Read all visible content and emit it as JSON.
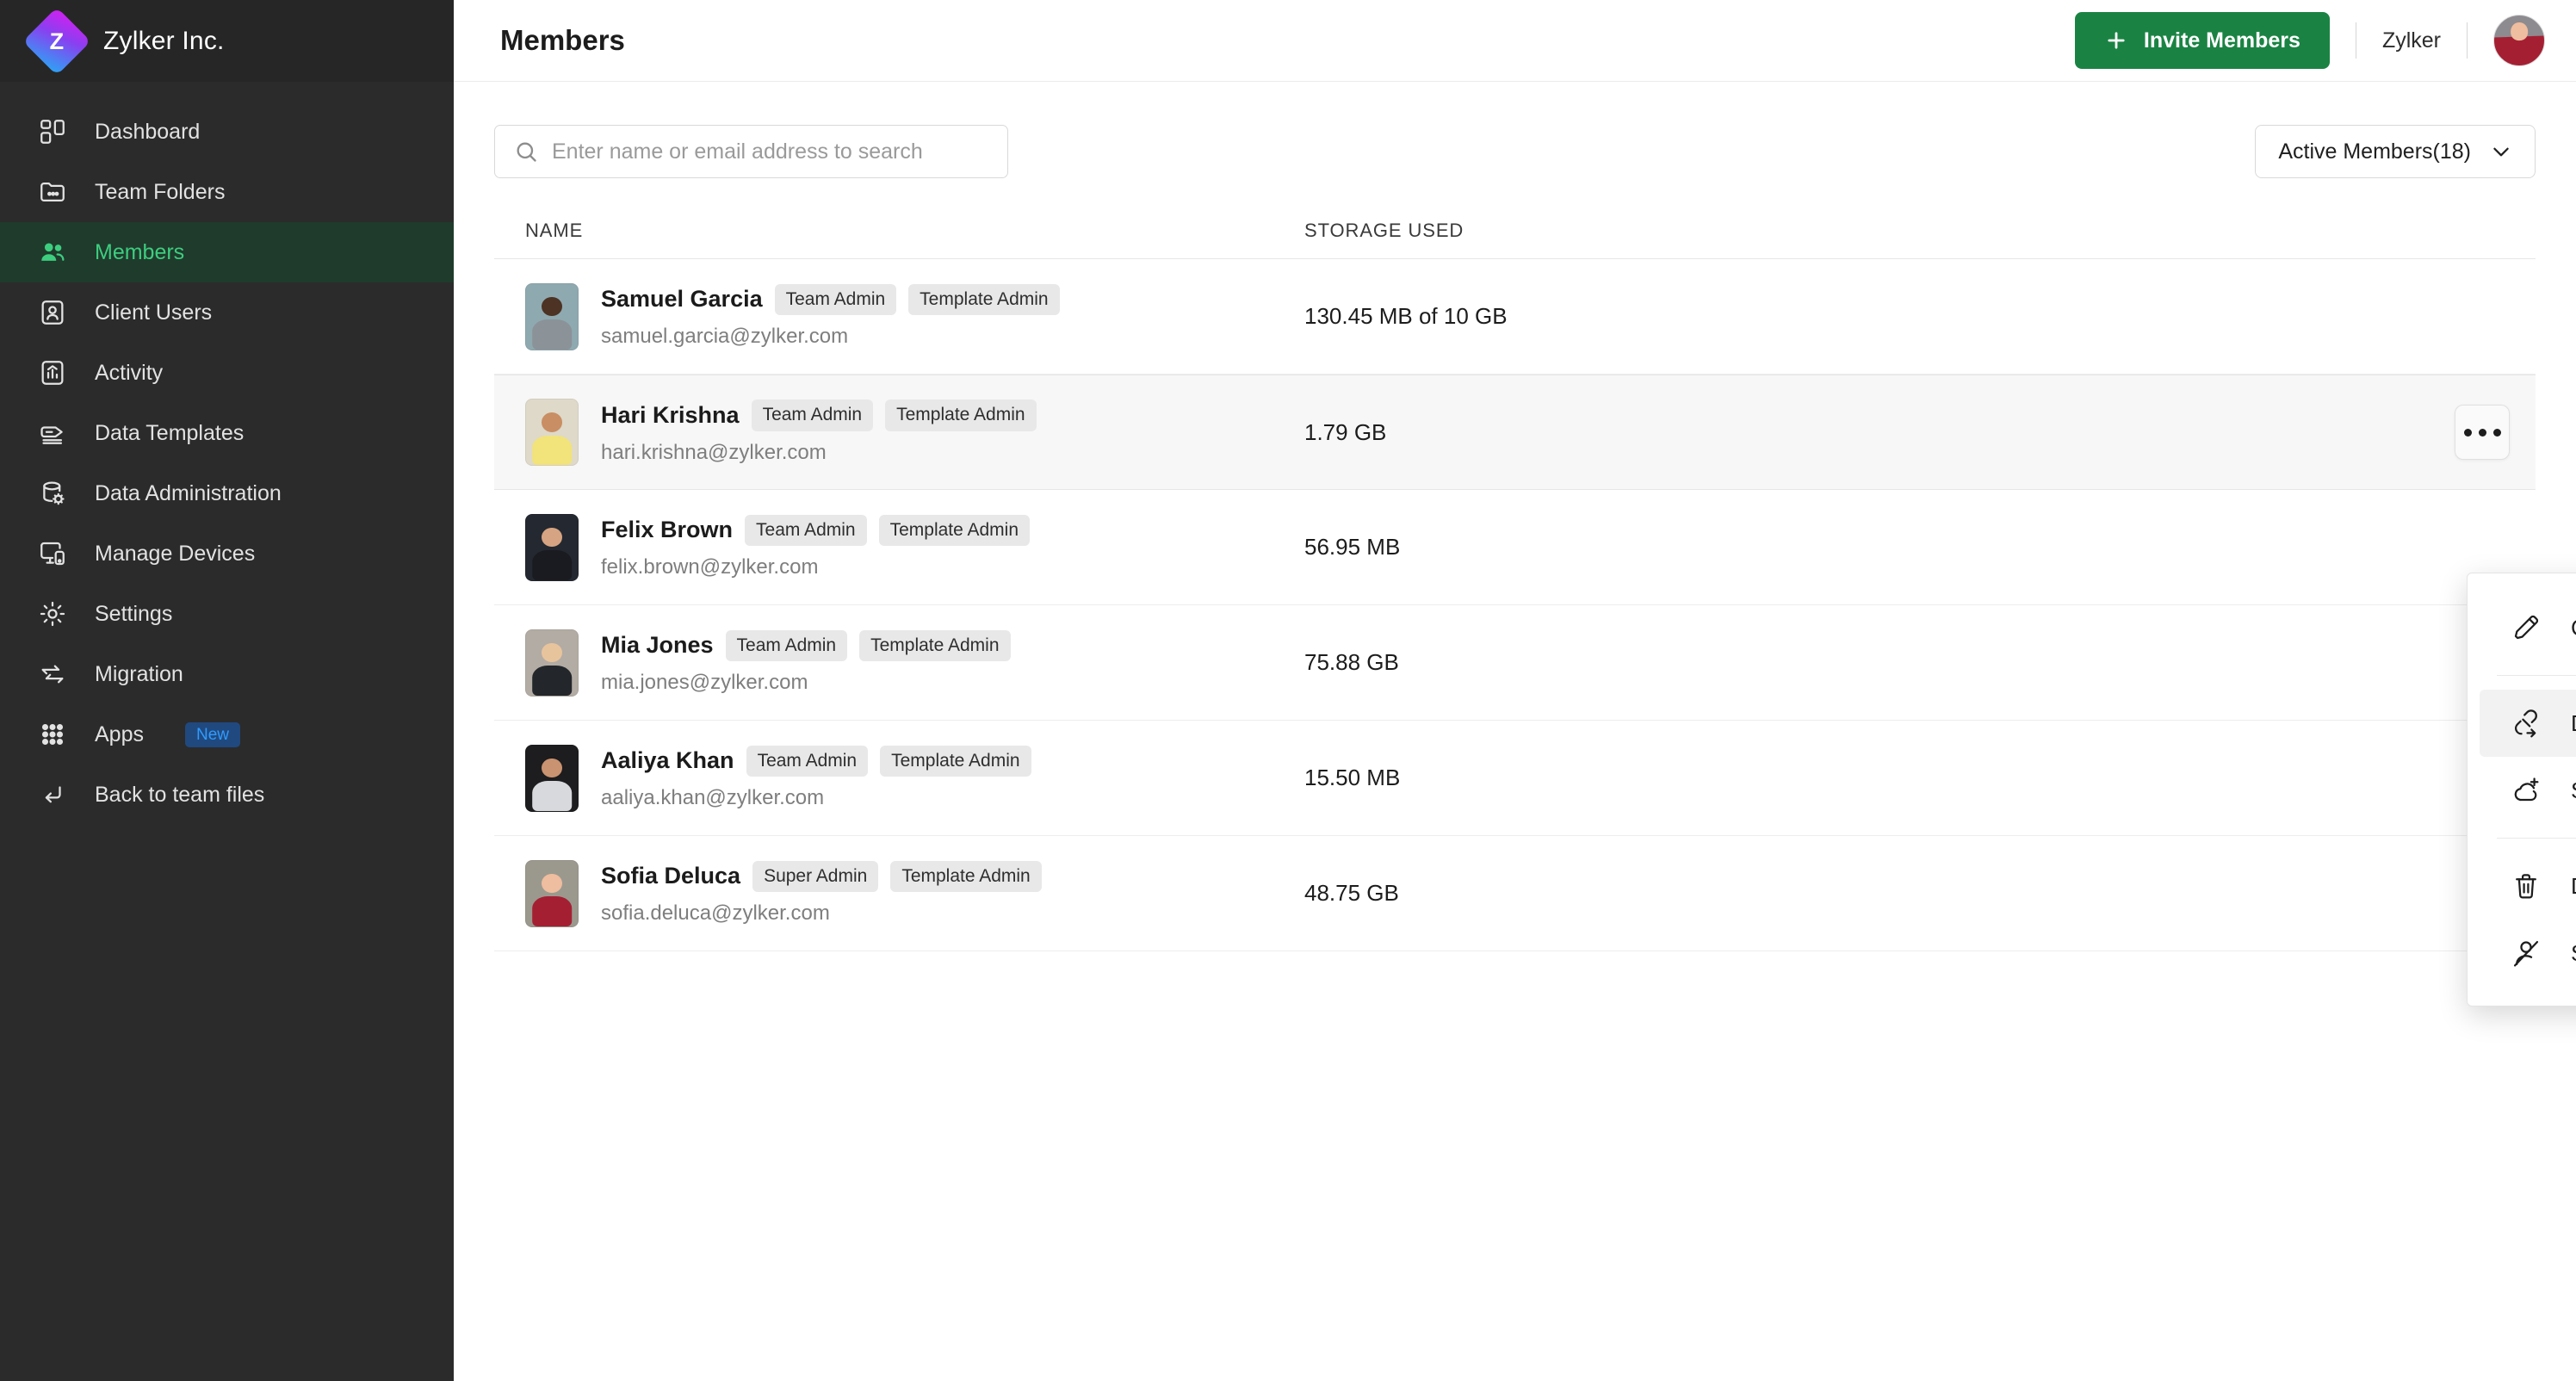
{
  "brand": {
    "name": "Zylker Inc.",
    "logo_letter": "Z",
    "logo_gradient_from": "#d41ff0",
    "logo_gradient_to": "#2aa6f5"
  },
  "sidebar": {
    "active_accent": "#3dcd7f",
    "active_bg": "#1f3b2c",
    "background": "#2b2b2b",
    "items": [
      {
        "label": "Dashboard",
        "icon": "grid-icon",
        "active": false
      },
      {
        "label": "Team Folders",
        "icon": "folder-share-icon",
        "active": false
      },
      {
        "label": "Members",
        "icon": "people-icon",
        "active": true
      },
      {
        "label": "Client Users",
        "icon": "user-card-icon",
        "active": false
      },
      {
        "label": "Activity",
        "icon": "chart-box-icon",
        "active": false
      },
      {
        "label": "Data Templates",
        "icon": "tag-stack-icon",
        "active": false
      },
      {
        "label": "Data Administration",
        "icon": "database-gear-icon",
        "active": false
      },
      {
        "label": "Manage Devices",
        "icon": "monitor-phone-icon",
        "active": false
      },
      {
        "label": "Settings",
        "icon": "gear-icon",
        "active": false
      },
      {
        "label": "Migration",
        "icon": "transfer-arrows-icon",
        "active": false
      },
      {
        "label": "Apps",
        "icon": "apps-grid-icon",
        "active": false,
        "badge": "New",
        "badge_bg": "#20497f",
        "badge_color": "#2f9bff"
      },
      {
        "label": "Back to team files",
        "icon": "return-arrow-icon",
        "active": false
      }
    ]
  },
  "topbar": {
    "title": "Members",
    "invite_label": "Invite Members",
    "invite_color": "#1a8343",
    "org_name": "Zylker",
    "avatar": "user-avatar"
  },
  "toolbar": {
    "search_placeholder": "Enter name or email address to search",
    "search_value": "",
    "filter_label": "Active Members(18)"
  },
  "table": {
    "columns": [
      "NAME",
      "STORAGE USED"
    ],
    "rows": [
      {
        "name": "Samuel Garcia",
        "tags": [
          "Team Admin",
          "Template Admin"
        ],
        "email": "samuel.garcia@zylker.com",
        "storage": "130.45 MB of 10 GB",
        "highlight": false,
        "avatar": {
          "bg": "#8fa9b0",
          "head": "#4c3324",
          "body": "#8b9298"
        }
      },
      {
        "name": "Hari Krishna",
        "tags": [
          "Team Admin",
          "Template Admin"
        ],
        "email": "hari.krishna@zylker.com",
        "storage": "1.79 GB",
        "highlight": true,
        "avatar": {
          "bg": "#ded9c9",
          "head": "#c98e63",
          "body": "#f2e37a"
        }
      },
      {
        "name": "Felix Brown",
        "tags": [
          "Team Admin",
          "Template Admin"
        ],
        "email": "felix.brown@zylker.com",
        "storage": "56.95 MB",
        "highlight": false,
        "avatar": {
          "bg": "#242830",
          "head": "#d6a482",
          "body": "#1a1b20"
        }
      },
      {
        "name": "Mia Jones",
        "tags": [
          "Team Admin",
          "Template Admin"
        ],
        "email": "mia.jones@zylker.com",
        "storage": "75.88 GB",
        "highlight": false,
        "avatar": {
          "bg": "#b3aca4",
          "head": "#e8c49d",
          "body": "#23262a"
        }
      },
      {
        "name": "Aaliya Khan",
        "tags": [
          "Team Admin",
          "Template Admin"
        ],
        "email": "aaliya.khan@zylker.com",
        "storage": "15.50 MB",
        "highlight": false,
        "avatar": {
          "bg": "#1d1c1e",
          "head": "#c99270",
          "body": "#d7d9dc"
        }
      },
      {
        "name": "Sofia Deluca",
        "tags": [
          "Super Admin",
          "Template Admin"
        ],
        "email": "sofia.deluca@zylker.com",
        "storage": "48.75 GB",
        "highlight": false,
        "avatar": {
          "bg": "#9b998e",
          "head": "#efbd9f",
          "body": "#a51f32"
        }
      }
    ]
  },
  "context_menu": {
    "items": [
      {
        "label": "Change Role",
        "icon": "pencil-icon",
        "submenu": true,
        "selected": false
      },
      {
        "label": "Disable External Sharing",
        "icon": "link-share-icon",
        "submenu": false,
        "selected": true
      },
      {
        "label": "Set Storage Limit",
        "icon": "cloud-plus-icon",
        "submenu": false,
        "selected": false
      },
      {
        "label": "Delete Member",
        "icon": "trash-icon",
        "submenu": false,
        "selected": false
      },
      {
        "label": "Suspend Member",
        "icon": "user-slash-icon",
        "submenu": false,
        "selected": false
      }
    ]
  }
}
